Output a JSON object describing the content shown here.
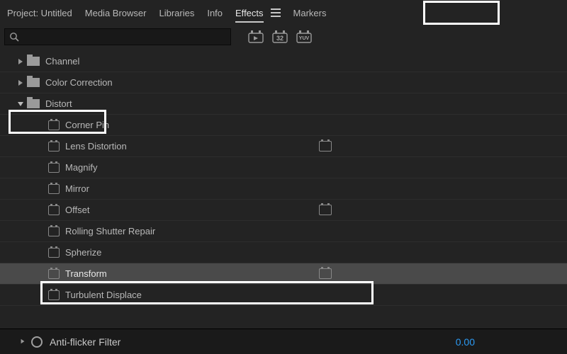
{
  "tabs": {
    "project": "Project: Untitled",
    "media_browser": "Media Browser",
    "libraries": "Libraries",
    "info": "Info",
    "effects": "Effects",
    "markers": "Markers"
  },
  "search": {
    "placeholder": ""
  },
  "filter_badges": {
    "b1": "",
    "b2": "32",
    "b3": "YUV"
  },
  "tree": {
    "channel": "Channel",
    "color_correction": "Color Correction",
    "distort": "Distort",
    "items": {
      "corner_pin": "Corner Pin",
      "lens_distortion": "Lens Distortion",
      "magnify": "Magnify",
      "mirror": "Mirror",
      "offset": "Offset",
      "rolling_shutter": "Rolling Shutter Repair",
      "spherize": "Spherize",
      "transform": "Transform",
      "turbulent_displace": "Turbulent Displace"
    }
  },
  "bottom": {
    "label": "Anti-flicker Filter",
    "value": "0.00"
  }
}
